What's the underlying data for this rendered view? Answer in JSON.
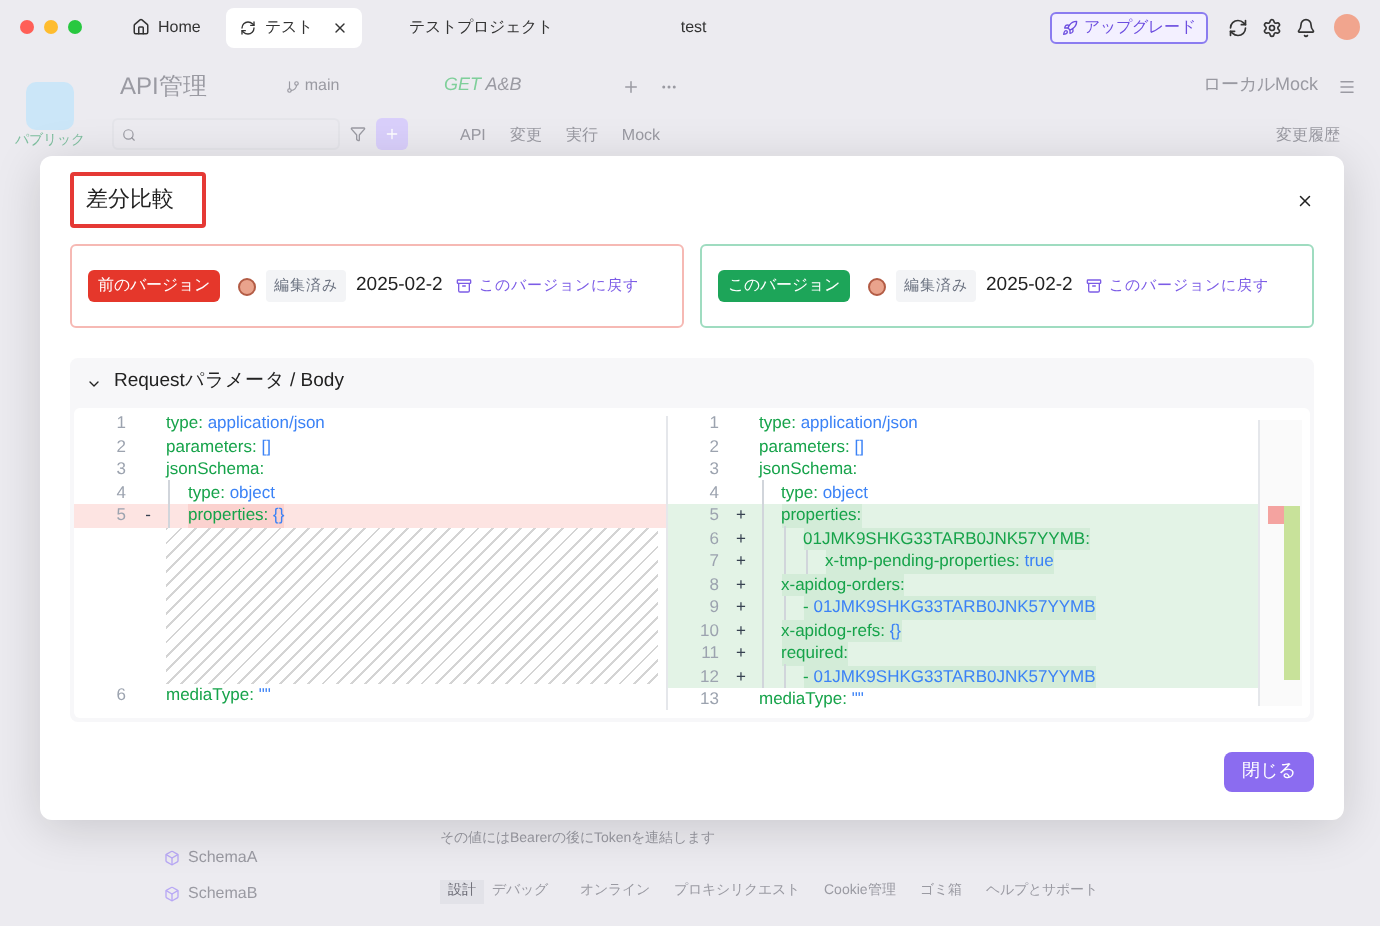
{
  "tabs": [
    {
      "label": "Home",
      "selected": false
    },
    {
      "label": "テスト",
      "selected": true
    },
    {
      "label": "テストプロジェクト",
      "selected": false
    },
    {
      "label": "test",
      "selected": false
    }
  ],
  "upgrade_button": "アップグレード",
  "background": {
    "team_label": "パブリック",
    "module_title": "API管理",
    "branch": "main",
    "endpoint_method": "GET",
    "endpoint_name": "A&B",
    "environment": "ローカルMock",
    "subtabs": [
      "API",
      "変更",
      "実行",
      "Mock"
    ],
    "history_link": "変更履歴",
    "tree_items": [
      "SchemaA",
      "SchemaB"
    ],
    "description": "その値にはBearerの後にTokenを連結します",
    "status_bar": {
      "modes": [
        {
          "label": "設計",
          "selected": true
        },
        {
          "label": "デバッグ",
          "selected": false
        }
      ],
      "items": [
        "オンライン",
        "プロキシリクエスト",
        "Cookie管理",
        "ゴミ箱",
        "ヘルプとサポート"
      ]
    }
  },
  "dialog": {
    "title": "差分比較",
    "versions": [
      {
        "kind": "previous",
        "badge": "前のバージョン",
        "status": "編集済み",
        "date": "2025-02-2",
        "restore_link": "このバージョンに戻す"
      },
      {
        "kind": "current",
        "badge": "このバージョン",
        "status": "編集済み",
        "date": "2025-02-2",
        "restore_link": "このバージョンに戻す"
      }
    ],
    "section": {
      "title": "Requestパラメータ / Body",
      "expanded": true,
      "left": [
        {
          "kind": "code",
          "num": "1",
          "key": "type:",
          "value": "application/json",
          "changed": false
        },
        {
          "kind": "code",
          "num": "2",
          "key": "parameters:",
          "value": "[]",
          "changed": false
        },
        {
          "kind": "code",
          "num": "3",
          "key": "jsonSchema:",
          "changed": false,
          "children": [
            {
              "kind": "code",
              "num": "4",
              "key": "type:",
              "value": "object",
              "changed": false
            },
            {
              "kind": "code",
              "num": "5",
              "key": "properties:",
              "value": "{}",
              "changed": true,
              "sign": "-"
            }
          ]
        },
        {
          "kind": "gap"
        },
        {
          "kind": "code",
          "num": "6",
          "key": "mediaType:",
          "value": "\"\"",
          "changed": false
        }
      ],
      "right": [
        {
          "kind": "code",
          "num": "1",
          "key": "type:",
          "value": "application/json",
          "changed": false
        },
        {
          "kind": "code",
          "num": "2",
          "key": "parameters:",
          "value": "[]",
          "changed": false
        },
        {
          "kind": "code",
          "num": "3",
          "key": "jsonSchema:",
          "changed": false,
          "children": [
            {
              "kind": "code",
              "num": "4",
              "key": "type:",
              "value": "object",
              "changed": false
            },
            {
              "kind": "code",
              "num": "5",
              "key": "properties:",
              "changed": true,
              "sign": "+",
              "children": [
                {
                  "kind": "code",
                  "num": "6",
                  "key": "01JMK9SHKG33TARB0JNK57YYMB:",
                  "changed": true,
                  "sign": "+",
                  "children": [
                    {
                      "kind": "code",
                      "num": "7",
                      "key": "x-tmp-pending-properties:",
                      "value": "true",
                      "changed": true,
                      "sign": "+"
                    }
                  ]
                }
              ]
            },
            {
              "kind": "code",
              "num": "8",
              "key": "x-apidog-orders:",
              "changed": true,
              "sign": "+",
              "children": [
                {
                  "kind": "code",
                  "num": "9",
                  "key": "-",
                  "value": "01JMK9SHKG33TARB0JNK57YYMB",
                  "changed": true,
                  "sign": "+"
                }
              ]
            },
            {
              "kind": "code",
              "num": "10",
              "key": "x-apidog-refs:",
              "value": "{}",
              "changed": true,
              "sign": "+"
            },
            {
              "kind": "code",
              "num": "11",
              "key": "required:",
              "changed": true,
              "sign": "+",
              "children": [
                {
                  "kind": "code",
                  "num": "12",
                  "key": "-",
                  "value": "01JMK9SHKG33TARB0JNK57YYMB",
                  "changed": true,
                  "sign": "+"
                }
              ]
            }
          ]
        },
        {
          "kind": "code",
          "num": "13",
          "key": "mediaType:",
          "value": "\"\"",
          "changed": false
        }
      ]
    },
    "close_button": "閉じる"
  }
}
